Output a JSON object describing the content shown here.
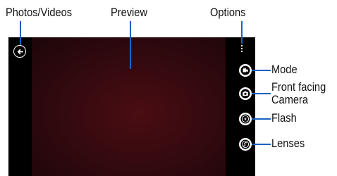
{
  "labels": {
    "photos_videos": "Photos/Videos",
    "preview": "Preview",
    "options": "Options",
    "mode": "Mode",
    "front_facing_line1": "Front facing",
    "front_facing_line2": "Camera",
    "flash": "Flash",
    "lenses": "Lenses"
  },
  "icons": {
    "back": "back-arrow-icon",
    "options": "vertical-dots-icon",
    "mode": "video-camera-icon",
    "front_camera": "camera-switch-icon",
    "flash": "flash-icon",
    "lenses": "lenses-icon"
  },
  "colors": {
    "callout_line": "#1a63c2",
    "preview_tint": "#350a10",
    "screen": "#000000"
  }
}
